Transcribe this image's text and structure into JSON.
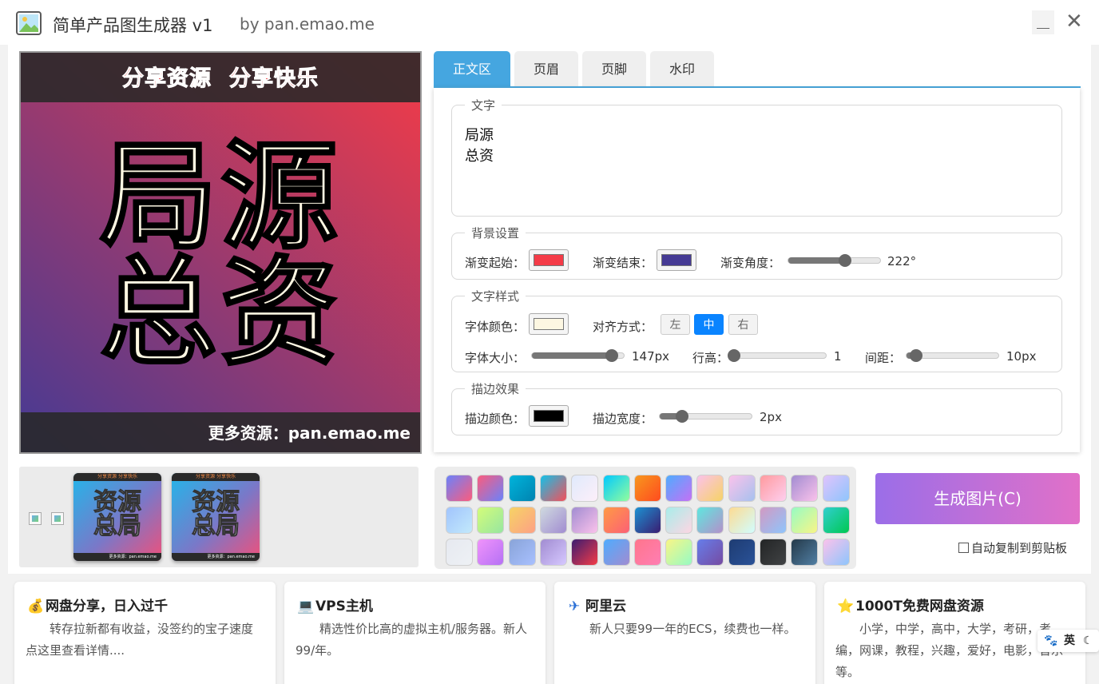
{
  "window": {
    "title": "简单产品图生成器 v1",
    "subtitle": "by pan.emao.me"
  },
  "preview": {
    "header": [
      "分享资源",
      "分享快乐"
    ],
    "main_text": "局源\n总资",
    "footer": "更多资源：pan.emao.me"
  },
  "tabs": [
    "正文区",
    "页眉",
    "页脚",
    "水印"
  ],
  "text_section": {
    "legend": "文字",
    "value": "局源\n总资"
  },
  "background": {
    "legend": "背景设置",
    "start_label": "渐变起始：",
    "start_color": "#f43b47",
    "end_label": "渐变结束：",
    "end_color": "#453a94",
    "angle_label": "渐变角度：",
    "angle_value": "222°",
    "angle_fraction": 0.62
  },
  "text_style": {
    "legend": "文字样式",
    "font_color_label": "字体颜色：",
    "font_color": "#fdf7e2",
    "align_label": "对齐方式：",
    "align_options": [
      "左",
      "中",
      "右"
    ],
    "align_selected": "中",
    "font_size_label": "字体大小：",
    "font_size_value": "147px",
    "font_size_fraction": 0.87,
    "line_height_label": "行高：",
    "line_height_value": "1",
    "line_height_fraction": 0.0,
    "spacing_label": "间距：",
    "spacing_value": "10px",
    "spacing_fraction": 0.1
  },
  "stroke": {
    "legend": "描边效果",
    "color_label": "描边颜色：",
    "color": "#000000",
    "width_label": "描边宽度：",
    "width_value": "2px",
    "width_fraction": 0.24
  },
  "thumbnails": [
    {
      "header": "分享资源 分享快乐",
      "text": "资源\n总局",
      "footer": "更多资源：pan.emao.me"
    },
    {
      "header": "分享资源 分享快乐",
      "text": "资源\n总局",
      "footer": "更多资源：pan.emao.me"
    }
  ],
  "palette": [
    [
      "#6a82fb,#fc5c7d",
      "#fc5c7d,#6a82fb",
      "#00b4db,#0083b0",
      "#12c2e9,#f64f59",
      "#e0eafc,#fdeff9",
      "#00c9ff,#92fe9d",
      "#f7971e,#ff4b1f",
      "#4facfe,#c471f5",
      "#fbc2eb,#f6d365",
      "#fbc2eb,#a6c1ee",
      "#ff9a9e,#fecfef",
      "#a18cd1,#fbc2eb",
      "#e0c3fc,#8ec5fc"
    ],
    [
      "#a1c4fd,#c2e9fb",
      "#d4fc79,#96e6a1",
      "#f6d365,#fda085",
      "#cfd9df,#a18cd1",
      "#a18cd1,#fbc2eb",
      "#ff9a44,#fc6076",
      "#1c92d2,#3a1c71",
      "#a8edea,#fed6e3",
      "#5ee7df,#b490ca",
      "#fddb92,#d1fdff",
      "#d299c2,#8ec5fc",
      "#96fbc4,#f9f586",
      "#30cfd0,#00c851"
    ],
    [
      "#e6e9f0,#eef1f5",
      "#f093fb,#b571f5",
      "#89a4d8,#a8c0ff",
      "#a18cd1,#d6c8ff",
      "#3a1c71,#f43b47",
      "#4facfe,#a18cd1",
      "#ff758c,#ff7eb3",
      "#f9f586,#96fbc4",
      "#667eea,#764ba2",
      "#1e3c72,#2a5298",
      "#232526,#414345",
      "#243949,#517fa4",
      "#fbc2eb,#8ec5fc"
    ]
  ],
  "generate_button": "生成图片(C)",
  "auto_copy_label": "自动复制到剪贴板",
  "ads": [
    {
      "icon": "💰",
      "title": "网盘分享，日入过千",
      "desc": "转存拉新都有收益，没签约的宝子速度点这里查看详情...."
    },
    {
      "icon": "💻",
      "title": "VPS主机",
      "desc": "精选性价比高的虚拟主机/服务器。新人99/年。"
    },
    {
      "icon": "✈",
      "title": "阿里云",
      "desc": "新人只要99一年的ECS，续费也一样。"
    },
    {
      "icon": "⭐",
      "title": "1000T免费网盘资源",
      "desc": "小学，中学，高中，大学，考研，考编，网课，教程，兴趣，爱好，电影，音乐等。"
    }
  ],
  "ime": {
    "lang": "英"
  },
  "icons": {
    "app": "image-icon",
    "minimize": "minimize-icon",
    "close": "close-icon"
  }
}
